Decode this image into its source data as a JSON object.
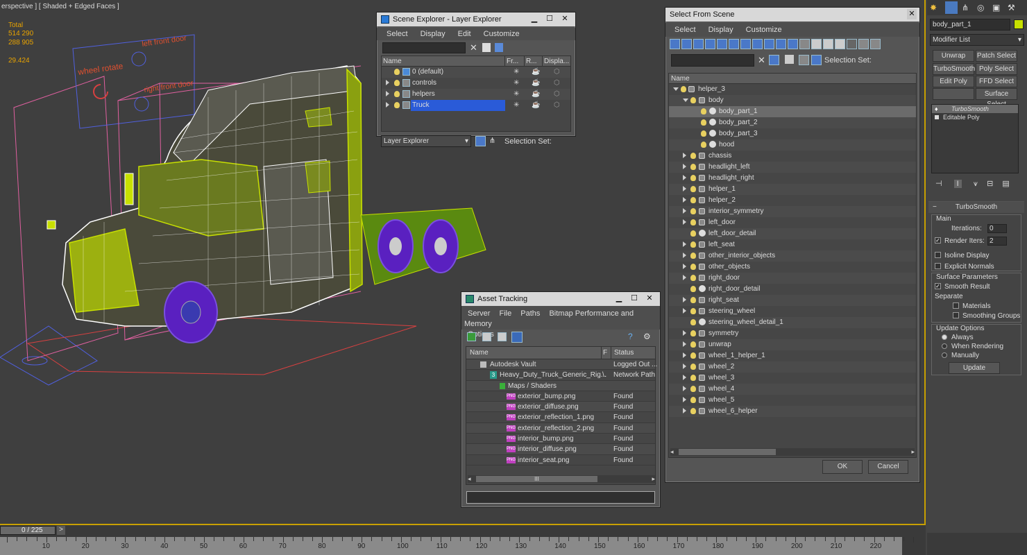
{
  "viewport": {
    "label": "erspective ] [ Shaded + Edged Faces ]",
    "stats": {
      "total_label": "Total",
      "polys": "514 290",
      "verts": "288 905",
      "fps": "29.424"
    },
    "annotations": {
      "left_front_door": "left front door",
      "wheel_rotate": "wheel rotate",
      "right_front_door": "right front door"
    }
  },
  "scene_explorer": {
    "title": "Scene Explorer - Layer Explorer",
    "menu": [
      "Select",
      "Display",
      "Edit",
      "Customize"
    ],
    "columns": [
      "Name",
      "Fr...",
      "R...",
      "Displa..."
    ],
    "rows": [
      {
        "name": "0 (default)"
      },
      {
        "name": "controls"
      },
      {
        "name": "helpers"
      },
      {
        "name": "Truck"
      }
    ],
    "footer_dropdown": "Layer Explorer",
    "selection_set_label": "Selection Set:"
  },
  "select_from_scene": {
    "title": "Select From Scene",
    "menu": [
      "Select",
      "Display",
      "Customize"
    ],
    "selection_set_label": "Selection Set:",
    "column_name": "Name",
    "root": "helper_3",
    "body": "body",
    "body_children": [
      "body_part_1",
      "body_part_2",
      "body_part_3",
      "hood"
    ],
    "items": [
      "chassis",
      "headlight_left",
      "headlight_right",
      "helper_1",
      "helper_2",
      "interior_symmetry",
      "left_door",
      "left_door_detail",
      "left_seat",
      "other_interior_objects",
      "other_objects",
      "right_door",
      "right_door_detail",
      "right_seat",
      "steering_wheel",
      "steering_wheel_detail_1",
      "symmetry",
      "unwrap",
      "wheel_1_helper_1",
      "wheel_2",
      "wheel_3",
      "wheel_4",
      "wheel_5",
      "wheel_6_helper"
    ],
    "ok_label": "OK",
    "cancel_label": "Cancel"
  },
  "asset_tracking": {
    "title": "Asset Tracking",
    "menu": [
      "Server",
      "File",
      "Paths",
      "Bitmap Performance and Memory",
      "Options"
    ],
    "columns": [
      "Name",
      "F",
      "Status"
    ],
    "rows": [
      {
        "name": "Autodesk Vault",
        "f": "",
        "status": "Logged Out ..."
      },
      {
        "name": "Heavy_Duty_Truck_Generic_Rig...",
        "f": "\\.",
        "status": "Network Path"
      },
      {
        "name": "Maps / Shaders",
        "f": "",
        "status": ""
      },
      {
        "name": "exterior_bump.png",
        "f": "",
        "status": "Found"
      },
      {
        "name": "exterior_diffuse.png",
        "f": "",
        "status": "Found"
      },
      {
        "name": "exterior_reflection_1.png",
        "f": "",
        "status": "Found"
      },
      {
        "name": "exterior_reflection_2.png",
        "f": "",
        "status": "Found"
      },
      {
        "name": "interior_bump.png",
        "f": "",
        "status": "Found"
      },
      {
        "name": "interior_diffuse.png",
        "f": "",
        "status": "Found"
      },
      {
        "name": "interior_seat.png",
        "f": "",
        "status": "Found"
      }
    ],
    "png_badge": "PNG",
    "scroll_grip": "III"
  },
  "command_panel": {
    "object_name": "body_part_1",
    "modifier_list": "Modifier List",
    "buttons": [
      "Unwrap UVW",
      "Patch Select",
      "TurboSmooth",
      "Poly Select",
      "Edit Poly",
      "FFD Select",
      "",
      "Surface Select"
    ],
    "stack": [
      "TurboSmooth",
      "Editable Poly"
    ],
    "rollout_title": "TurboSmooth",
    "main_label": "Main",
    "iterations_label": "Iterations:",
    "iterations_value": "0",
    "render_iters_label": "Render Iters:",
    "render_iters_value": "2",
    "isoline_label": "Isoline Display",
    "explicit_normals_label": "Explicit Normals",
    "surface_params_label": "Surface Parameters",
    "smooth_result_label": "Smooth Result",
    "separate_label": "Separate",
    "materials_label": "Materials",
    "smoothing_groups_label": "Smoothing Groups",
    "update_options_label": "Update Options",
    "always_label": "Always",
    "when_rendering_label": "When Rendering",
    "manually_label": "Manually",
    "update_label": "Update"
  },
  "timeline": {
    "frame": "0 / 225",
    "next": ">",
    "ticks": [
      "10",
      "20",
      "30",
      "40",
      "50",
      "60",
      "70",
      "80",
      "90",
      "100",
      "110",
      "120",
      "130",
      "140",
      "150",
      "160",
      "170",
      "180",
      "190",
      "200",
      "210",
      "220"
    ]
  },
  "colors": {
    "accent": "#c8a000",
    "selection": "#2a5bd8",
    "wire_green": "#c8e000",
    "wire_white": "#ffffff",
    "wheel_purple": "#6a30d8"
  }
}
